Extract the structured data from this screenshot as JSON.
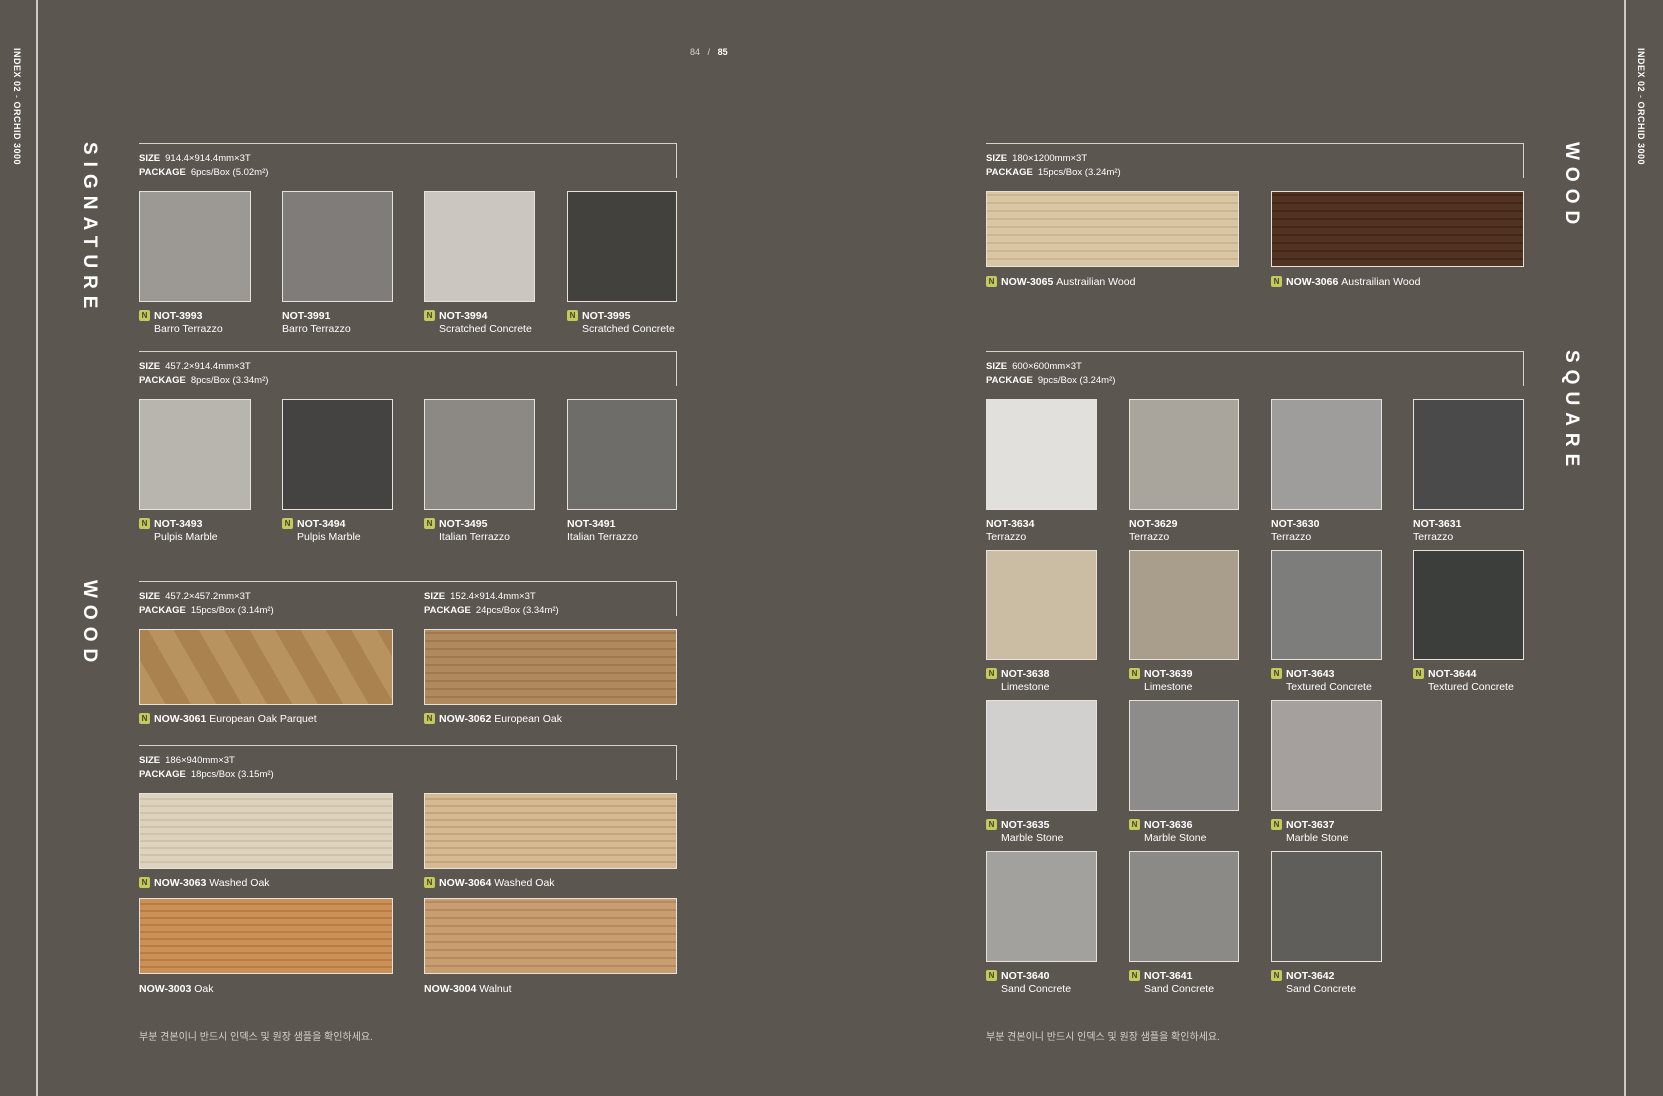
{
  "index_label": {
    "bold": "INDEX 02",
    "sep": " - ",
    "title": "ORCHID 3000"
  },
  "pagination": {
    "left": "84",
    "sep": "/",
    "right": "85"
  },
  "badge": "N",
  "titles": {
    "signature": "SIGNATURE",
    "wood_left": "WOOD",
    "wood_right": "WOOD",
    "square": "SQUARE"
  },
  "note": "부분 견본이니 반드시 인덱스 및 원장 샘플을 확인하세요.",
  "labels": {
    "size": "SIZE",
    "package": "PACKAGE"
  },
  "signature_a": {
    "size": "914.4×914.4mm×3T",
    "package": "6pcs/Box (5.02m²)",
    "items": [
      {
        "code": "NOT-3993",
        "name": "Barro Terrazzo",
        "is_new": true,
        "color": "#9c9893"
      },
      {
        "code": "NOT-3991",
        "name": "Barro Terrazzo",
        "is_new": false,
        "color": "#7f7c79"
      },
      {
        "code": "NOT-3994",
        "name": "Scratched Concrete",
        "is_new": true,
        "color": "#cbc7c0"
      },
      {
        "code": "NOT-3995",
        "name": "Scratched Concrete",
        "is_new": true,
        "color": "#43413d"
      }
    ]
  },
  "signature_b": {
    "size": "457.2×914.4mm×3T",
    "package": "8pcs/Box (3.34m²)",
    "items": [
      {
        "code": "NOT-3493",
        "name": "Pulpis Marble",
        "is_new": true,
        "color": "#b8b5ae"
      },
      {
        "code": "NOT-3494",
        "name": "Pulpis Marble",
        "is_new": true,
        "color": "#444341"
      },
      {
        "code": "NOT-3495",
        "name": "Italian Terrazzo",
        "is_new": true,
        "color": "#8c8985"
      },
      {
        "code": "NOT-3491",
        "name": "Italian Terrazzo",
        "is_new": false,
        "color": "#6f6d6a"
      }
    ]
  },
  "wood_a": {
    "size": "457.2×457.2mm×3T",
    "package": "15pcs/Box (3.14m²)",
    "item": {
      "code": "NOW-3061",
      "name": "European Oak Parquet",
      "is_new": true,
      "color": "#b38d5e"
    }
  },
  "wood_b": {
    "size": "152.4×914.4mm×3T",
    "package": "24pcs/Box (3.34m²)",
    "item": {
      "code": "NOW-3062",
      "name": "European Oak",
      "is_new": true,
      "color": "#ad8659"
    }
  },
  "wood_c": {
    "size": "186×940mm×3T",
    "package": "18pcs/Box (3.15m²)",
    "items": [
      {
        "code": "NOW-3063",
        "name": "Washed Oak",
        "is_new": true,
        "color": "#d9cdb6"
      },
      {
        "code": "NOW-3064",
        "name": "Washed Oak",
        "is_new": true,
        "color": "#cfb38b"
      },
      {
        "code": "NOW-3003",
        "name": "Oak",
        "is_new": false,
        "color": "#c78c4e"
      },
      {
        "code": "NOW-3004",
        "name": "Walnut",
        "is_new": false,
        "color": "#c59a6c"
      }
    ]
  },
  "wood_right": {
    "size": "180×1200mm×3T",
    "package": "15pcs/Box (3.24m²)",
    "items": [
      {
        "code": "NOW-3065",
        "name": "Austrailian Wood",
        "is_new": true,
        "color": "#d6c3a1"
      },
      {
        "code": "NOW-3066",
        "name": "Austrailian Wood",
        "is_new": true,
        "color": "#4f2f1c"
      }
    ]
  },
  "square": {
    "size": "600×600mm×3T",
    "package": "9pcs/Box (3.24m²)",
    "items": [
      {
        "code": "NOT-3634",
        "name": "Terrazzo",
        "is_new": false,
        "color": "#e2e0dd"
      },
      {
        "code": "NOT-3629",
        "name": "Terrazzo",
        "is_new": false,
        "color": "#a9a49c"
      },
      {
        "code": "NOT-3630",
        "name": "Terrazzo",
        "is_new": false,
        "color": "#9e9d9b"
      },
      {
        "code": "NOT-3631",
        "name": "Terrazzo",
        "is_new": false,
        "color": "#4a4a4a"
      },
      {
        "code": "NOT-3638",
        "name": "Limestone",
        "is_new": true,
        "color": "#cabda4"
      },
      {
        "code": "NOT-3639",
        "name": "Limestone",
        "is_new": true,
        "color": "#a99d8c"
      },
      {
        "code": "NOT-3643",
        "name": "Textured Concrete",
        "is_new": true,
        "color": "#7d7e7b"
      },
      {
        "code": "NOT-3644",
        "name": "Textured Concrete",
        "is_new": true,
        "color": "#3c3e3b"
      },
      {
        "code": "NOT-3635",
        "name": "Marble Stone",
        "is_new": true,
        "color": "#d2d0ce"
      },
      {
        "code": "NOT-3636",
        "name": "Marble Stone",
        "is_new": true,
        "color": "#8e8c8b"
      },
      {
        "code": "NOT-3637",
        "name": "Marble Stone",
        "is_new": true,
        "color": "#a5a09e"
      },
      {
        "code": "NOT-3640",
        "name": "Sand Concrete",
        "is_new": true,
        "color": "#a3a19e"
      },
      {
        "code": "NOT-3641",
        "name": "Sand Concrete",
        "is_new": true,
        "color": "#8c8a87"
      },
      {
        "code": "NOT-3642",
        "name": "Sand Concrete",
        "is_new": true,
        "color": "#5f5e5a"
      }
    ]
  }
}
